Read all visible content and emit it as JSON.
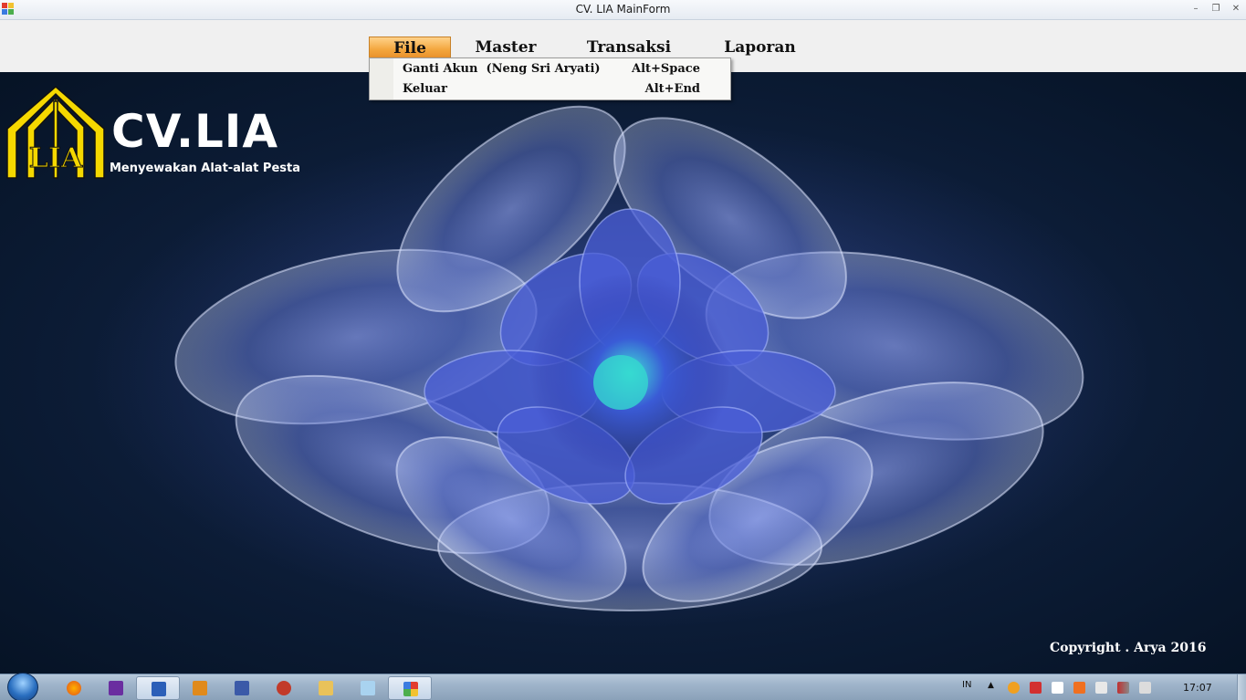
{
  "window": {
    "title": "CV. LIA MainForm"
  },
  "menu": {
    "items": [
      {
        "label": "File"
      },
      {
        "label": "Master"
      },
      {
        "label": "Transaksi"
      },
      {
        "label": "Laporan"
      }
    ],
    "file_dropdown": [
      {
        "label": "Ganti Akun  (Neng Sri Aryati)",
        "shortcut": "Alt+Space"
      },
      {
        "label": "Keluar",
        "shortcut": "Alt+End"
      }
    ]
  },
  "logo": {
    "title": "CV.LIA",
    "emblem_text": "LIA",
    "tagline": "Menyewakan Alat-alat Pesta"
  },
  "copyright": "Copyright . Arya 2016",
  "taskbar": {
    "apps": [
      "start",
      "firefox",
      "visual-studio",
      "word",
      "media-player",
      "vb6",
      "tool",
      "explorer",
      "notepad",
      "cv-lia-mainform"
    ],
    "tray": {
      "language": "IN",
      "time": "17:07"
    }
  },
  "colors": {
    "menu_active": "#f3a53c",
    "logo_yellow": "#f5d800",
    "wallpaper_dark": "#0c1c36"
  }
}
